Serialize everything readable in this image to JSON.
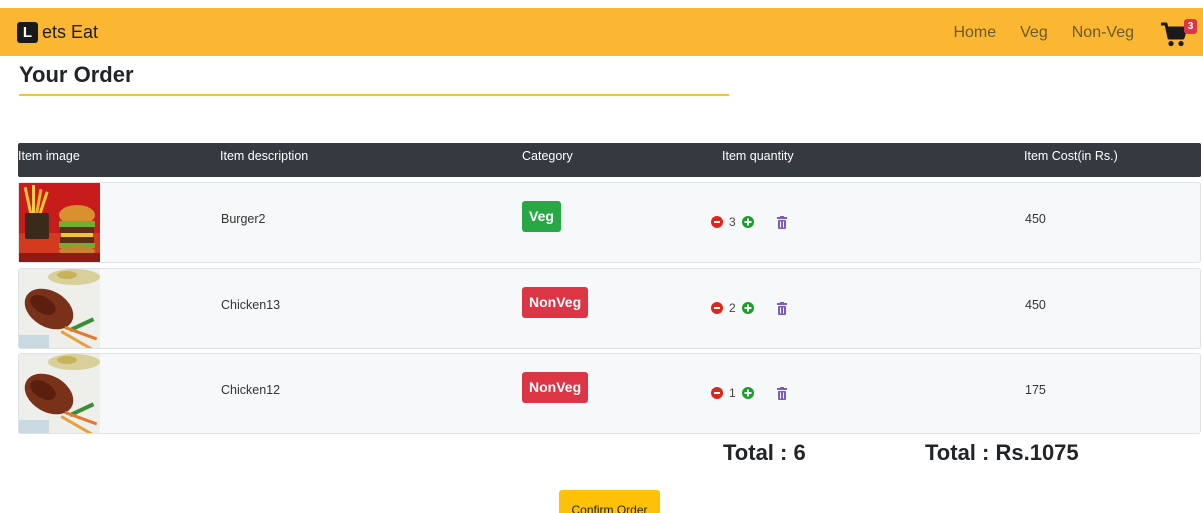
{
  "navbar": {
    "brand_letter": "L",
    "brand_text": "ets Eat",
    "links": [
      "Home",
      "Veg",
      "Non-Veg"
    ],
    "cart_count": "3",
    "bg_color": "#fbb731"
  },
  "page": {
    "title": "Your Order"
  },
  "table": {
    "headers": [
      "Item image",
      "Item description",
      "Category",
      "Item quantity",
      "Item Cost(in Rs.)"
    ],
    "rows": [
      {
        "image": "burger-fries-image",
        "description": "Burger2",
        "category": "Veg",
        "quantity": "3",
        "cost": "450"
      },
      {
        "image": "chicken-leg-image",
        "description": "Chicken13",
        "category": "NonVeg",
        "quantity": "2",
        "cost": "450"
      },
      {
        "image": "chicken-leg-image",
        "description": "Chicken12",
        "category": "NonVeg",
        "quantity": "1",
        "cost": "175"
      }
    ]
  },
  "totals": {
    "items": "Total : 6",
    "amount": "Total : Rs.1075"
  },
  "confirm_label": "Confirm Order",
  "colors": {
    "veg": "#28a745",
    "nonveg": "#dc3545",
    "header_bg": "#343a40",
    "accent": "#ffc107"
  }
}
